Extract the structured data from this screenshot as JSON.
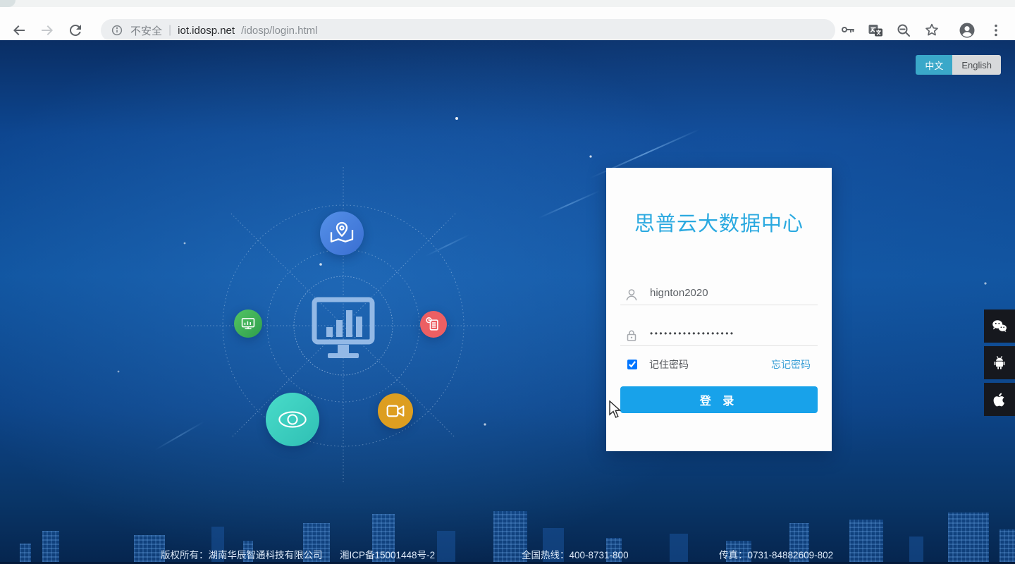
{
  "browser": {
    "security_label": "不安全",
    "separator": "|",
    "url_host": "iot.idosp.net",
    "url_path": "/idosp/login.html"
  },
  "language_toggle": {
    "chinese": "中文",
    "english": "English",
    "active": "chinese"
  },
  "login": {
    "title": "思普云大数据中心",
    "username": "hignton2020",
    "password_masked": "••••••••••••••••••",
    "remember_label": "记住密码",
    "remember_checked": "checked",
    "forgot_label": "忘记密码",
    "submit_label": "登 录"
  },
  "footer": {
    "copyright": "版权所有：湖南华辰智通科技有限公司",
    "icp": "湘ICP备15001448号-2",
    "hotline": "全国热线：400-8731-800",
    "fax": "传真：0731-84882609-802"
  },
  "hub": {
    "center_icon": "monitor-bar-chart-icon",
    "satellites": [
      {
        "icon": "map-location-icon",
        "color": "#4a85e2"
      },
      {
        "icon": "mini-monitor-icon",
        "color": "#3fb45a"
      },
      {
        "icon": "report-document-icon",
        "color": "#ec5f63"
      },
      {
        "icon": "eye-icon",
        "color": "#3fd0c0"
      },
      {
        "icon": "video-camera-icon",
        "color": "#dd9e20"
      }
    ]
  },
  "app_rail": {
    "items": [
      "wechat-icon",
      "android-icon",
      "apple-icon"
    ]
  },
  "colors": {
    "accent_button": "#18a2ea",
    "title_blue": "#2aa9e0",
    "language_active": "#3aa8c9",
    "link_blue": "#3a9fd6",
    "page_top": "#0a2e64",
    "page_mid": "#10549f"
  }
}
